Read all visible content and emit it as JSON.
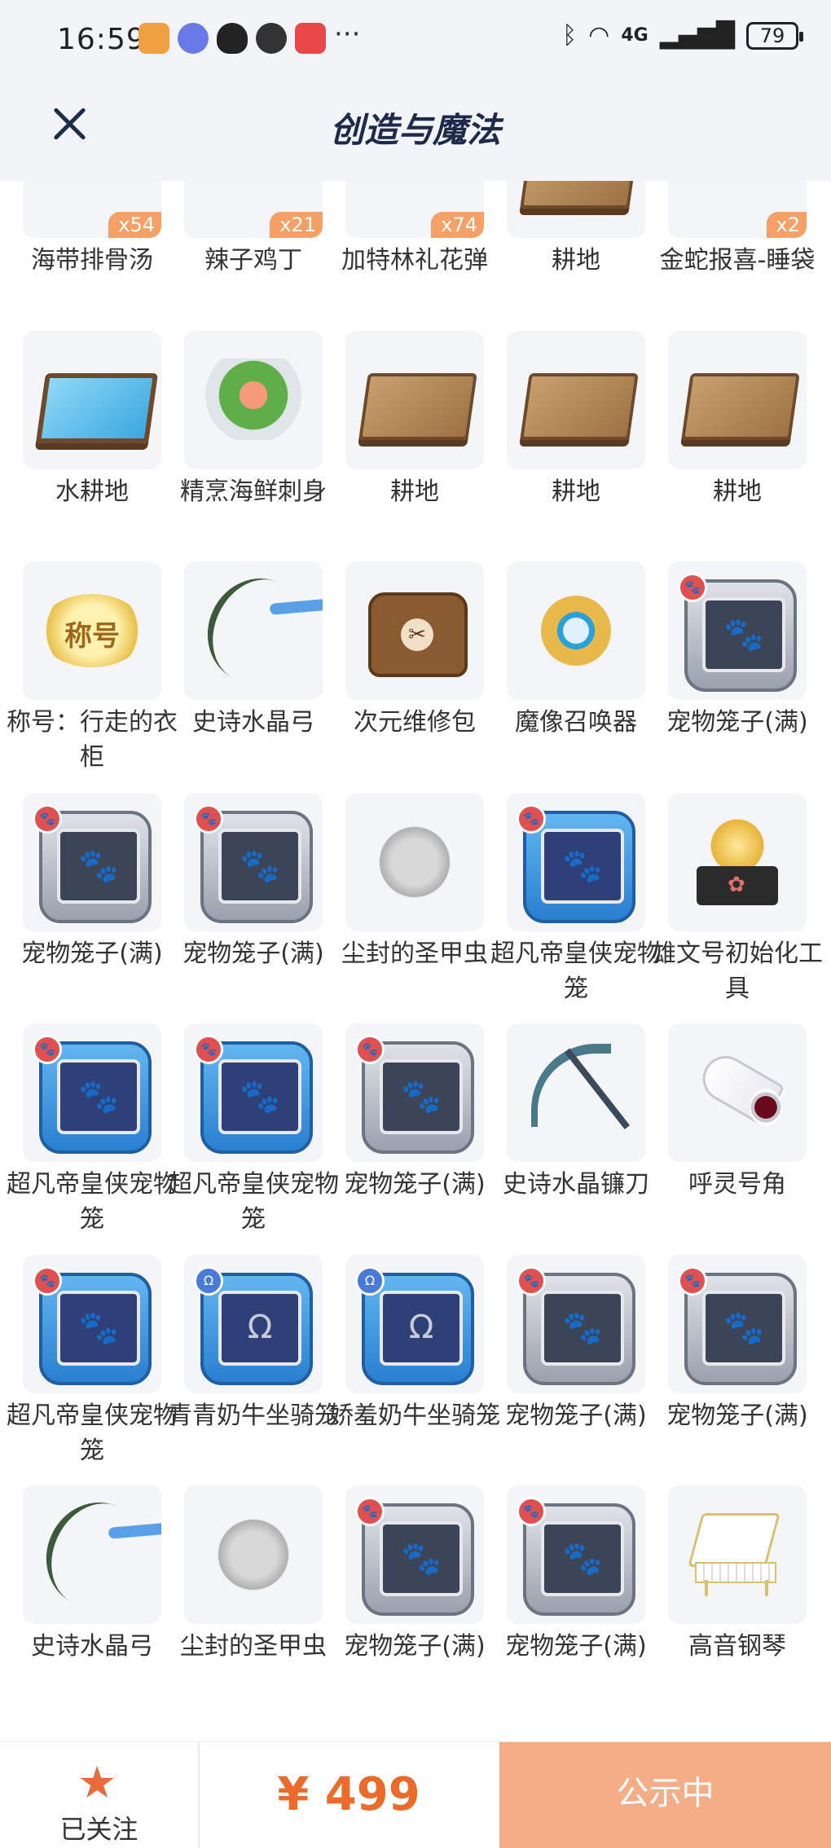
{
  "status_bar": {
    "time": "16:59",
    "battery": "79",
    "network": "4G"
  },
  "header": {
    "title": "创造与魔法"
  },
  "items": [
    {
      "name": "海带排骨汤",
      "qty": "x54",
      "icon": "soup"
    },
    {
      "name": "辣子鸡丁",
      "qty": "x21",
      "icon": "dish"
    },
    {
      "name": "加特林礼花弹",
      "qty": "x74",
      "icon": "bomb"
    },
    {
      "name": "耕地",
      "qty": "",
      "icon": "farmland"
    },
    {
      "name": "金蛇报喜-睡袋",
      "qty": "x2",
      "icon": "sleeping-bag"
    },
    {
      "name": "水耕地",
      "qty": "",
      "icon": "water-farmland"
    },
    {
      "name": "精烹海鲜刺身",
      "qty": "",
      "icon": "sashimi"
    },
    {
      "name": "耕地",
      "qty": "",
      "icon": "farmland"
    },
    {
      "name": "耕地",
      "qty": "",
      "icon": "farmland"
    },
    {
      "name": "耕地",
      "qty": "",
      "icon": "farmland"
    },
    {
      "name": "称号：行走的衣柜",
      "qty": "",
      "icon": "title-badge"
    },
    {
      "name": "史诗水晶弓",
      "qty": "",
      "icon": "bow"
    },
    {
      "name": "次元维修包",
      "qty": "",
      "icon": "repair-bag"
    },
    {
      "name": "魔像召唤器",
      "qty": "",
      "icon": "summoner"
    },
    {
      "name": "宠物笼子(满)",
      "qty": "",
      "icon": "pet-cage"
    },
    {
      "name": "宠物笼子(满)",
      "qty": "",
      "icon": "pet-cage"
    },
    {
      "name": "宠物笼子(满)",
      "qty": "",
      "icon": "pet-cage"
    },
    {
      "name": "尘封的圣甲虫",
      "qty": "",
      "icon": "beetle"
    },
    {
      "name": "超凡帝皇侠宠物笼",
      "qty": "",
      "icon": "pet-cage-blue"
    },
    {
      "name": "雄文号初始化工具",
      "qty": "",
      "icon": "tool-box"
    },
    {
      "name": "超凡帝皇侠宠物笼",
      "qty": "",
      "icon": "pet-cage-blue"
    },
    {
      "name": "超凡帝皇侠宠物笼",
      "qty": "",
      "icon": "pet-cage-blue"
    },
    {
      "name": "宠物笼子(满)",
      "qty": "",
      "icon": "pet-cage"
    },
    {
      "name": "史诗水晶镰刀",
      "qty": "",
      "icon": "scythe"
    },
    {
      "name": "呼灵号角",
      "qty": "",
      "icon": "horn"
    },
    {
      "name": "超凡帝皇侠宠物笼",
      "qty": "",
      "icon": "pet-cage-blue"
    },
    {
      "name": "青青奶牛坐骑笼",
      "qty": "",
      "icon": "mount-cage"
    },
    {
      "name": "娇羞奶牛坐骑笼",
      "qty": "",
      "icon": "mount-cage"
    },
    {
      "name": "宠物笼子(满)",
      "qty": "",
      "icon": "pet-cage"
    },
    {
      "name": "宠物笼子(满)",
      "qty": "",
      "icon": "pet-cage"
    },
    {
      "name": "史诗水晶弓",
      "qty": "",
      "icon": "bow"
    },
    {
      "name": "尘封的圣甲虫",
      "qty": "",
      "icon": "beetle"
    },
    {
      "name": "宠物笼子(满)",
      "qty": "",
      "icon": "pet-cage"
    },
    {
      "name": "宠物笼子(满)",
      "qty": "",
      "icon": "pet-cage"
    },
    {
      "name": "高音钢琴",
      "qty": "",
      "icon": "piano"
    }
  ],
  "footer": {
    "follow_label": "已关注",
    "price": "¥ 499",
    "status_label": "公示中"
  },
  "colors": {
    "accent": "#ec6a2a",
    "status_button": "#f4ad86",
    "qty_badge": "#f5a066",
    "header_bg": "#f2f4f7"
  }
}
